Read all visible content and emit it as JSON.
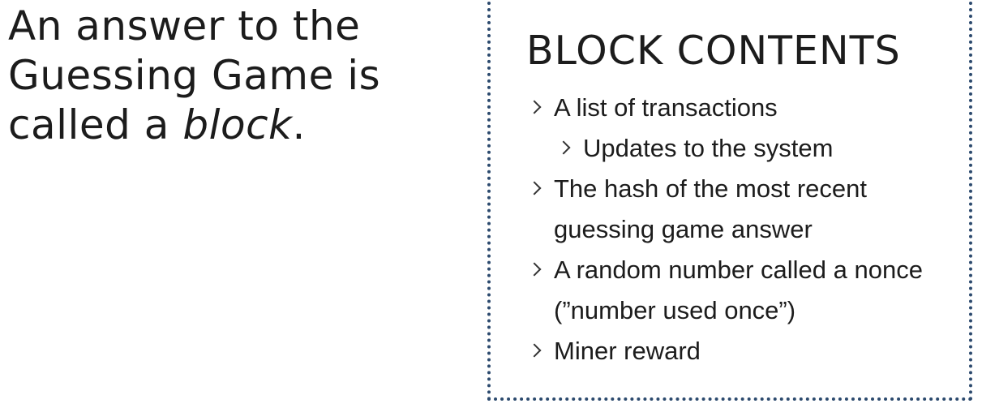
{
  "headline": {
    "line1": "An answer to the",
    "line2": "Guessing Game is",
    "line3_prefix": "called a ",
    "line3_emphasis": "block",
    "line3_suffix": "."
  },
  "block_contents": {
    "title": "BLOCK CONTENTS",
    "items": [
      {
        "text": "A list of transactions",
        "level": 1,
        "icon": "chevron-right-icon"
      },
      {
        "text": "Updates to the system",
        "level": 2,
        "icon": "chevron-right-icon"
      },
      {
        "text": "The hash of the most recent",
        "level": 1,
        "icon": "chevron-right-icon"
      },
      {
        "text": "guessing game answer",
        "level": 1,
        "continuation": true
      },
      {
        "text": "A random number called a nonce",
        "level": 1,
        "icon": "chevron-right-icon"
      },
      {
        "text": "(”number used once”)",
        "level": 1,
        "continuation": true
      },
      {
        "text": "Miner reward",
        "level": 1,
        "icon": "chevron-right-icon"
      }
    ]
  },
  "colors": {
    "text": "#1c1c1c",
    "border": "#2c4a6e",
    "background": "#ffffff"
  }
}
